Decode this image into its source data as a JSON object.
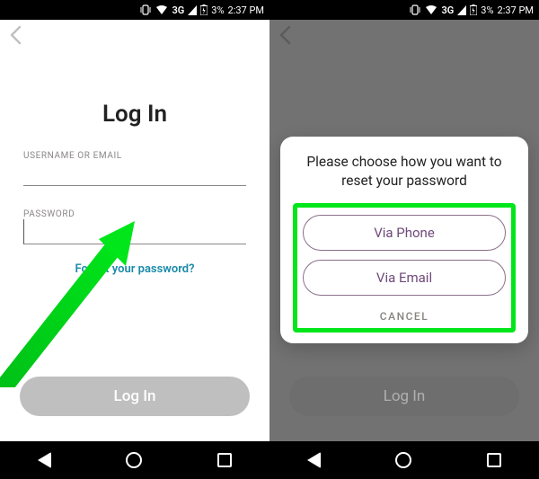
{
  "status": {
    "network": "3G",
    "battery_pct": "3%",
    "time": "2:37 PM"
  },
  "left": {
    "title": "Log In",
    "username_label": "USERNAME OR EMAIL",
    "password_label": "PASSWORD",
    "forgot_link": "Forgot your password?",
    "login_button": "Log In"
  },
  "right": {
    "modal_title": "Please choose how you want to reset your password",
    "via_phone": "Via Phone",
    "via_email": "Via Email",
    "cancel": "CANCEL",
    "login_button": "Log In"
  }
}
